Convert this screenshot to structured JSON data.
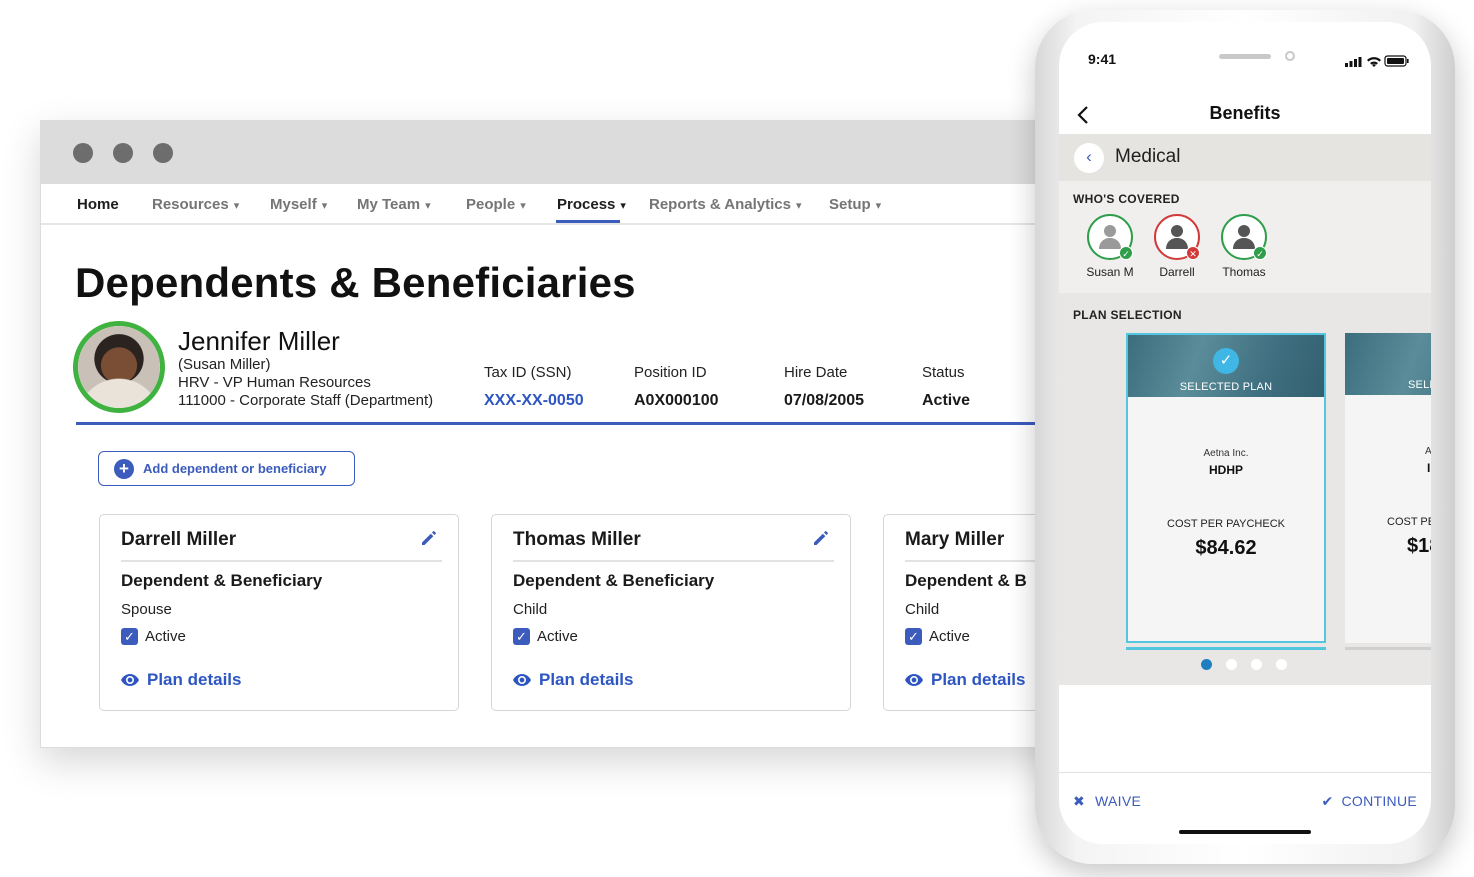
{
  "nav": {
    "items": [
      {
        "label": "Home",
        "caret": ""
      },
      {
        "label": "Resources",
        "caret": "▾"
      },
      {
        "label": "Myself",
        "caret": "▾"
      },
      {
        "label": "My Team",
        "caret": "▾"
      },
      {
        "label": "People",
        "caret": "▾"
      },
      {
        "label": "Process",
        "caret": "▾"
      },
      {
        "label": "Reports & Analytics",
        "caret": "▾"
      },
      {
        "label": "Setup",
        "caret": "▾"
      }
    ],
    "active": "Process"
  },
  "page": {
    "title": "Dependents & Beneficiaries"
  },
  "employee": {
    "name": "Jennifer Miller",
    "alias": "(Susan Miller)",
    "position": "HRV - VP Human Resources",
    "department": "111000 - Corporate Staff (Department)"
  },
  "fields": [
    {
      "label": "Tax ID (SSN)",
      "value": "XXX-XX-0050"
    },
    {
      "label": "Position ID",
      "value": "A0X000100"
    },
    {
      "label": "Hire Date",
      "value": "07/08/2005"
    },
    {
      "label": "Status",
      "value": "Active"
    }
  ],
  "add_button": {
    "icon": "plus-icon",
    "label": "Add dependent or beneficiary"
  },
  "cards": [
    {
      "name": "Darrell Miller",
      "type": "Dependent & Beneficiary",
      "relation": "Spouse",
      "active_label": "Active",
      "active": true,
      "plan_link": "Plan details"
    },
    {
      "name": "Thomas Miller",
      "type": "Dependent & Beneficiary",
      "relation": "Child",
      "active_label": "Active",
      "active": true,
      "plan_link": "Plan details"
    },
    {
      "name": "Mary Miller",
      "type": "Dependent & B",
      "relation": "Child",
      "active_label": "Active",
      "active": true,
      "plan_link": "Plan details"
    }
  ],
  "colors": {
    "accent": "#3b5bbd",
    "link": "#2d56c2",
    "success": "#3fb23f",
    "danger": "#d23a3a",
    "selection": "#55c6e0"
  },
  "phone": {
    "time": "9:41",
    "title": "Benefits",
    "section": {
      "back_icon": "chevron-left-icon",
      "label": "Medical"
    },
    "whos_covered": {
      "title": "WHO'S COVERED",
      "members": [
        {
          "name": "Susan M",
          "status": "covered"
        },
        {
          "name": "Darrell",
          "status": "not-covered"
        },
        {
          "name": "Thomas",
          "status": "covered"
        }
      ]
    },
    "plan_selection": {
      "title": "PLAN SELECTION",
      "cards": [
        {
          "selected_label": "SELECTED PLAN",
          "carrier": "Aetna Inc.",
          "plan": "HDHP",
          "cost_label": "COST PER PAYCHECK",
          "cost": "$84.62"
        },
        {
          "selected_label": "SELE",
          "carrier": "Ae",
          "plan": "I",
          "cost_label": "COST PE",
          "cost": "$18"
        }
      ],
      "pager": {
        "count": 4,
        "current": 1
      }
    },
    "footer": {
      "waive": "WAIVE",
      "continue": "CONTINUE"
    }
  }
}
